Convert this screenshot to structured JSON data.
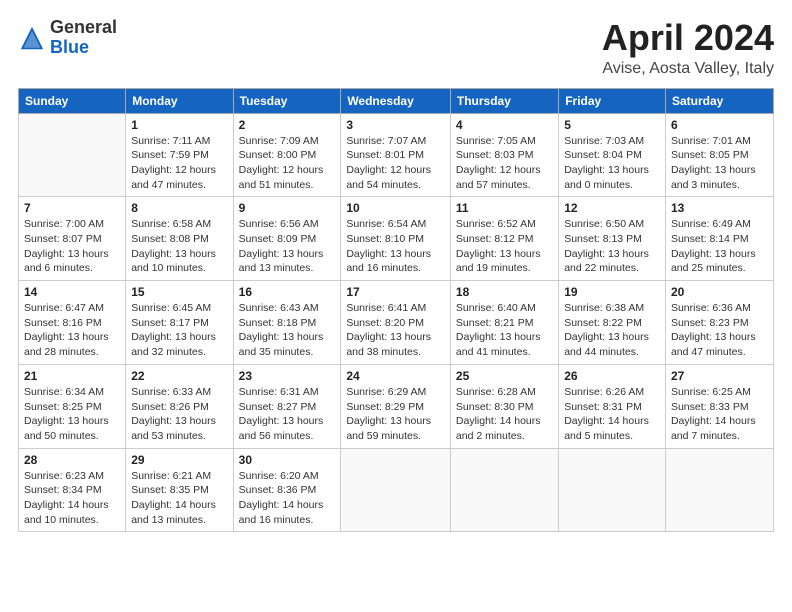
{
  "header": {
    "logo_general": "General",
    "logo_blue": "Blue",
    "month": "April 2024",
    "location": "Avise, Aosta Valley, Italy"
  },
  "weekdays": [
    "Sunday",
    "Monday",
    "Tuesday",
    "Wednesday",
    "Thursday",
    "Friday",
    "Saturday"
  ],
  "weeks": [
    [
      {
        "day": "",
        "info": ""
      },
      {
        "day": "1",
        "info": "Sunrise: 7:11 AM\nSunset: 7:59 PM\nDaylight: 12 hours\nand 47 minutes."
      },
      {
        "day": "2",
        "info": "Sunrise: 7:09 AM\nSunset: 8:00 PM\nDaylight: 12 hours\nand 51 minutes."
      },
      {
        "day": "3",
        "info": "Sunrise: 7:07 AM\nSunset: 8:01 PM\nDaylight: 12 hours\nand 54 minutes."
      },
      {
        "day": "4",
        "info": "Sunrise: 7:05 AM\nSunset: 8:03 PM\nDaylight: 12 hours\nand 57 minutes."
      },
      {
        "day": "5",
        "info": "Sunrise: 7:03 AM\nSunset: 8:04 PM\nDaylight: 13 hours\nand 0 minutes."
      },
      {
        "day": "6",
        "info": "Sunrise: 7:01 AM\nSunset: 8:05 PM\nDaylight: 13 hours\nand 3 minutes."
      }
    ],
    [
      {
        "day": "7",
        "info": "Sunrise: 7:00 AM\nSunset: 8:07 PM\nDaylight: 13 hours\nand 6 minutes."
      },
      {
        "day": "8",
        "info": "Sunrise: 6:58 AM\nSunset: 8:08 PM\nDaylight: 13 hours\nand 10 minutes."
      },
      {
        "day": "9",
        "info": "Sunrise: 6:56 AM\nSunset: 8:09 PM\nDaylight: 13 hours\nand 13 minutes."
      },
      {
        "day": "10",
        "info": "Sunrise: 6:54 AM\nSunset: 8:10 PM\nDaylight: 13 hours\nand 16 minutes."
      },
      {
        "day": "11",
        "info": "Sunrise: 6:52 AM\nSunset: 8:12 PM\nDaylight: 13 hours\nand 19 minutes."
      },
      {
        "day": "12",
        "info": "Sunrise: 6:50 AM\nSunset: 8:13 PM\nDaylight: 13 hours\nand 22 minutes."
      },
      {
        "day": "13",
        "info": "Sunrise: 6:49 AM\nSunset: 8:14 PM\nDaylight: 13 hours\nand 25 minutes."
      }
    ],
    [
      {
        "day": "14",
        "info": "Sunrise: 6:47 AM\nSunset: 8:16 PM\nDaylight: 13 hours\nand 28 minutes."
      },
      {
        "day": "15",
        "info": "Sunrise: 6:45 AM\nSunset: 8:17 PM\nDaylight: 13 hours\nand 32 minutes."
      },
      {
        "day": "16",
        "info": "Sunrise: 6:43 AM\nSunset: 8:18 PM\nDaylight: 13 hours\nand 35 minutes."
      },
      {
        "day": "17",
        "info": "Sunrise: 6:41 AM\nSunset: 8:20 PM\nDaylight: 13 hours\nand 38 minutes."
      },
      {
        "day": "18",
        "info": "Sunrise: 6:40 AM\nSunset: 8:21 PM\nDaylight: 13 hours\nand 41 minutes."
      },
      {
        "day": "19",
        "info": "Sunrise: 6:38 AM\nSunset: 8:22 PM\nDaylight: 13 hours\nand 44 minutes."
      },
      {
        "day": "20",
        "info": "Sunrise: 6:36 AM\nSunset: 8:23 PM\nDaylight: 13 hours\nand 47 minutes."
      }
    ],
    [
      {
        "day": "21",
        "info": "Sunrise: 6:34 AM\nSunset: 8:25 PM\nDaylight: 13 hours\nand 50 minutes."
      },
      {
        "day": "22",
        "info": "Sunrise: 6:33 AM\nSunset: 8:26 PM\nDaylight: 13 hours\nand 53 minutes."
      },
      {
        "day": "23",
        "info": "Sunrise: 6:31 AM\nSunset: 8:27 PM\nDaylight: 13 hours\nand 56 minutes."
      },
      {
        "day": "24",
        "info": "Sunrise: 6:29 AM\nSunset: 8:29 PM\nDaylight: 13 hours\nand 59 minutes."
      },
      {
        "day": "25",
        "info": "Sunrise: 6:28 AM\nSunset: 8:30 PM\nDaylight: 14 hours\nand 2 minutes."
      },
      {
        "day": "26",
        "info": "Sunrise: 6:26 AM\nSunset: 8:31 PM\nDaylight: 14 hours\nand 5 minutes."
      },
      {
        "day": "27",
        "info": "Sunrise: 6:25 AM\nSunset: 8:33 PM\nDaylight: 14 hours\nand 7 minutes."
      }
    ],
    [
      {
        "day": "28",
        "info": "Sunrise: 6:23 AM\nSunset: 8:34 PM\nDaylight: 14 hours\nand 10 minutes."
      },
      {
        "day": "29",
        "info": "Sunrise: 6:21 AM\nSunset: 8:35 PM\nDaylight: 14 hours\nand 13 minutes."
      },
      {
        "day": "30",
        "info": "Sunrise: 6:20 AM\nSunset: 8:36 PM\nDaylight: 14 hours\nand 16 minutes."
      },
      {
        "day": "",
        "info": ""
      },
      {
        "day": "",
        "info": ""
      },
      {
        "day": "",
        "info": ""
      },
      {
        "day": "",
        "info": ""
      }
    ]
  ]
}
